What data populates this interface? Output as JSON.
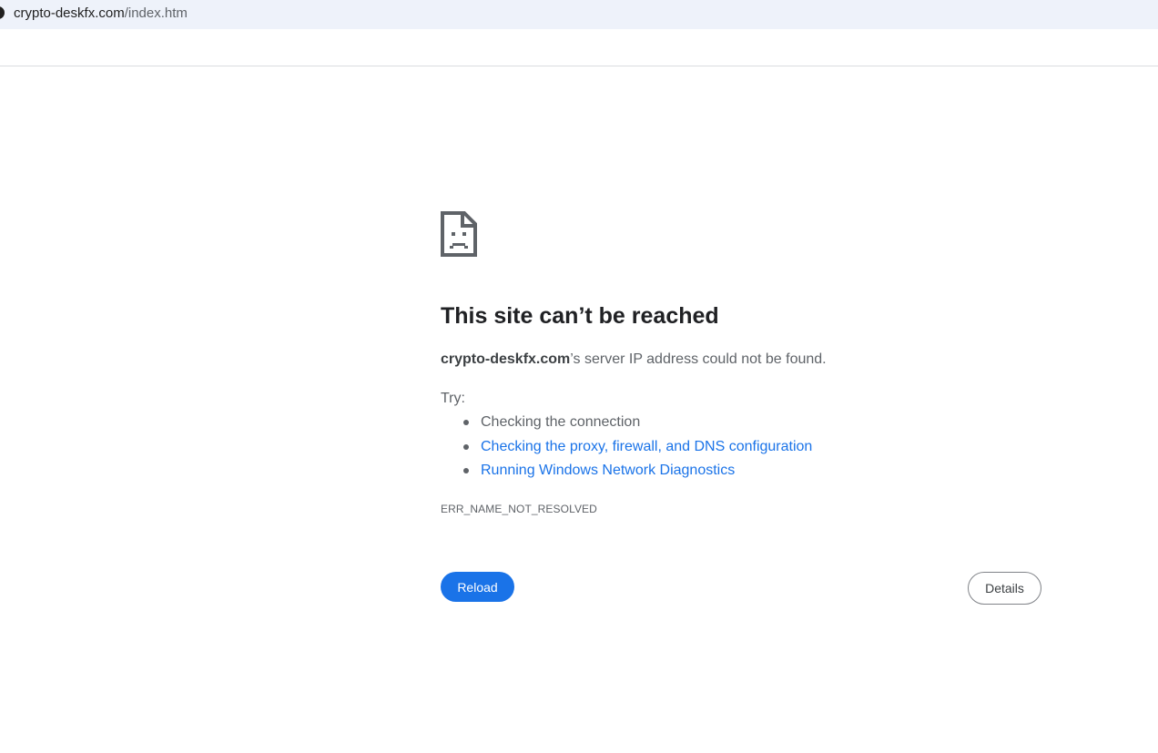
{
  "browser": {
    "url_host": "crypto-deskfx.com",
    "url_path": "/index.htm"
  },
  "error_page": {
    "icon": "sad-page-icon",
    "title": "This site can’t be reached",
    "summary_host": "crypto-deskfx.com",
    "summary_rest": "’s server IP address could not be found.",
    "try_label": "Try:",
    "suggestions": [
      {
        "label": "Checking the connection",
        "is_link": false
      },
      {
        "label": "Checking the proxy, firewall, and DNS configuration",
        "is_link": true
      },
      {
        "label": "Running Windows Network Diagnostics",
        "is_link": true
      }
    ],
    "error_code": "ERR_NAME_NOT_RESOLVED",
    "reload_label": "Reload",
    "details_label": "Details"
  },
  "colors": {
    "omnibox_bg": "#eef2fa",
    "link": "#1a73e8",
    "primary_button": "#1a73e8",
    "body_text": "#5f6368",
    "title_text": "#202124"
  }
}
